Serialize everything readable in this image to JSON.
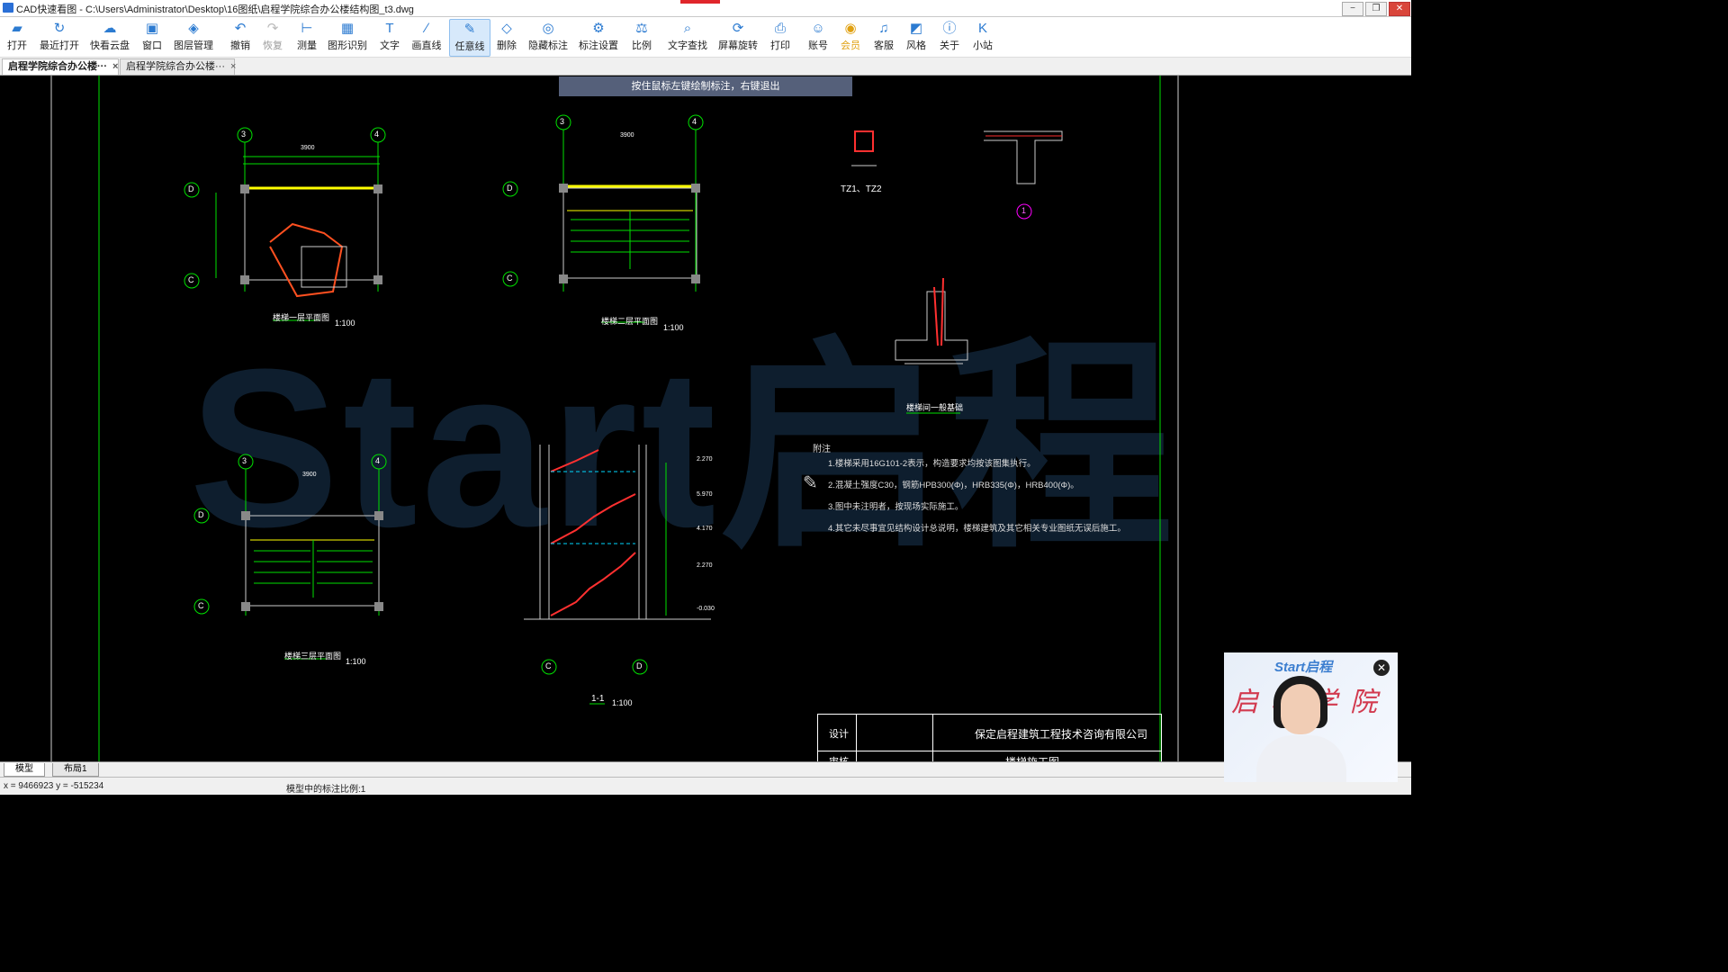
{
  "window": {
    "title": "CAD快速看图 - C:\\Users\\Administrator\\Desktop\\16图纸\\启程学院综合办公楼结构图_t3.dwg",
    "controls": [
      "−",
      "❐",
      "✕"
    ]
  },
  "toolbar": {
    "items": [
      {
        "label": "打开",
        "icon": "folder-icon",
        "glyph": "▰"
      },
      {
        "label": "最近打开",
        "icon": "history-icon",
        "glyph": "↻"
      },
      {
        "label": "快看云盘",
        "icon": "cloud-icon",
        "glyph": "☁"
      },
      {
        "label": "窗口",
        "icon": "window-icon",
        "glyph": "▣"
      },
      {
        "label": "图层管理",
        "icon": "layers-icon",
        "glyph": "◈"
      },
      {
        "label": "撤销",
        "icon": "undo-icon",
        "glyph": "↶"
      },
      {
        "label": "恢复",
        "icon": "redo-icon",
        "glyph": "↷"
      },
      {
        "label": "测量",
        "icon": "measure-icon",
        "glyph": "⊢"
      },
      {
        "label": "图形识别",
        "icon": "shape-recognize-icon",
        "glyph": "▦"
      },
      {
        "label": "文字",
        "icon": "text-icon",
        "glyph": "T"
      },
      {
        "label": "画直线",
        "icon": "line-icon",
        "glyph": "∕"
      },
      {
        "label": "任意线",
        "icon": "freehand-icon",
        "glyph": "✎"
      },
      {
        "label": "删除",
        "icon": "eraser-icon",
        "glyph": "◇"
      },
      {
        "label": "隐藏标注",
        "icon": "hide-icon",
        "glyph": "◎"
      },
      {
        "label": "标注设置",
        "icon": "annotation-settings-icon",
        "glyph": "⚙"
      },
      {
        "label": "比例",
        "icon": "scale-icon",
        "glyph": "⚖"
      },
      {
        "label": "文字查找",
        "icon": "text-search-icon",
        "glyph": "⌕"
      },
      {
        "label": "屏幕旋转",
        "icon": "rotate-icon",
        "glyph": "⟳"
      },
      {
        "label": "打印",
        "icon": "printer-icon",
        "glyph": "⎙"
      },
      {
        "label": "账号",
        "icon": "user-icon",
        "glyph": "☺"
      },
      {
        "label": "会员",
        "icon": "vip-icon",
        "glyph": "◉"
      },
      {
        "label": "客服",
        "icon": "headset-icon",
        "glyph": "♫"
      },
      {
        "label": "风格",
        "icon": "style-icon",
        "glyph": "◩"
      },
      {
        "label": "关于",
        "icon": "info-icon",
        "glyph": "ⓘ"
      },
      {
        "label": "小站",
        "icon": "k-icon",
        "glyph": "K"
      }
    ]
  },
  "tabs": [
    {
      "label": "启程学院综合办公楼···",
      "active": true
    },
    {
      "label": "启程学院综合办公楼···",
      "active": false
    }
  ],
  "canvas": {
    "hint": "按住鼠标左键绘制标注，右键退出",
    "watermark": "Start启程"
  },
  "drawing": {
    "plan1_title": "楼梯一层平面图",
    "plan2_title": "楼梯二层平面图",
    "plan3_title": "楼梯三层平面图",
    "section_title": "1-1",
    "foundation_title": "楼梯间一般基础",
    "scale": "1:100",
    "axis": [
      "3",
      "4",
      "D",
      "C",
      "1"
    ],
    "tz_label": "TZ1、TZ2",
    "elevations": [
      "2.270",
      "5.970",
      "4.170",
      "2.270",
      "-0.030"
    ],
    "dims_top": "3900",
    "notes_title": "附注",
    "notes": [
      "1.楼梯采用16G101-2表示，构造要求均按该图集执行。",
      "2.混凝土强度C30，钢筋HPB300(Φ)，HRB335(Φ)，HRB400(Φ)。",
      "3.图中未注明者，按现场实际施工。",
      "4.其它未尽事宜见结构设计总说明，楼梯建筑及其它相关专业图纸无误后施工。"
    ],
    "title_block": {
      "row1_label": "设计",
      "company": "保定启程建筑工程技术咨询有限公司",
      "row2_label": "审核",
      "sheet": "楼梯施工图"
    }
  },
  "model_tabs": [
    "模型",
    "布局1"
  ],
  "status": {
    "coords": "x = 9466923  y = -515234",
    "scale_text": "模型中的标注比例:1"
  },
  "webcam": {
    "brand": "Start启程",
    "school": "启程学院",
    "close": "✕"
  },
  "colors": {
    "accent": "#2c7bd1",
    "cad_green": "#00e000",
    "cad_cyan": "#00d8ff",
    "cad_red": "#ff3030",
    "cad_yellow": "#ffff00",
    "cad_magenta": "#ff00ff"
  }
}
